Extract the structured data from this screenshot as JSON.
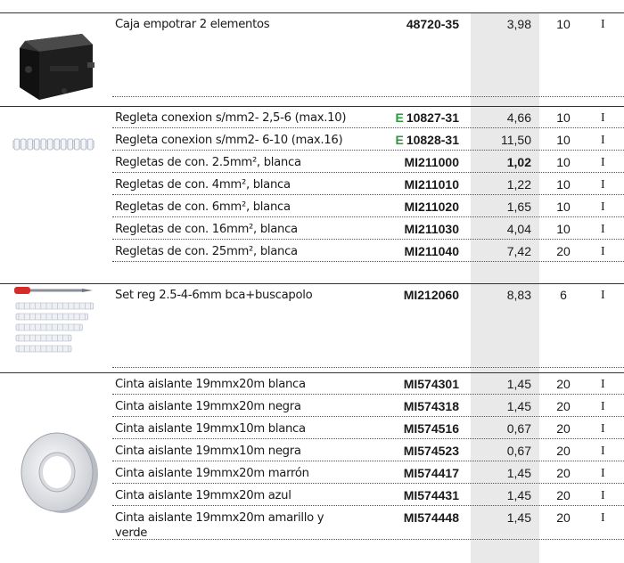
{
  "groups": [
    {
      "image": {
        "icon": "junction-box-image"
      },
      "items": [
        {
          "description": "Caja empotrar 2 elementos",
          "eco": "",
          "code": "48720-35",
          "price": "3,98",
          "qty": "10",
          "unit": "I",
          "bold_price": false
        }
      ]
    },
    {
      "image": {
        "icon": "terminal-strip-image"
      },
      "items": [
        {
          "description": "Regleta conexion s/mm2- 2,5-6 (max.10)",
          "eco": "E",
          "code": "10827-31",
          "price": "4,66",
          "qty": "10",
          "unit": "I",
          "bold_price": false
        },
        {
          "description": "Regleta conexion s/mm2- 6-10 (max.16)",
          "eco": "E",
          "code": "10828-31",
          "price": "11,50",
          "qty": "10",
          "unit": "I",
          "bold_price": false
        },
        {
          "description": "Regletas de con. 2.5mm², blanca",
          "eco": "",
          "code": "MI211000",
          "price": "1,02",
          "qty": "10",
          "unit": "I",
          "bold_price": true
        },
        {
          "description": "Regletas de con. 4mm², blanca",
          "eco": "",
          "code": "MI211010",
          "price": "1,22",
          "qty": "10",
          "unit": "I",
          "bold_price": false
        },
        {
          "description": "Regletas de con. 6mm², blanca",
          "eco": "",
          "code": "MI211020",
          "price": "1,65",
          "qty": "10",
          "unit": "I",
          "bold_price": false
        },
        {
          "description": "Regletas de con. 16mm², blanca",
          "eco": "",
          "code": "MI211030",
          "price": "4,04",
          "qty": "10",
          "unit": "I",
          "bold_price": false
        },
        {
          "description": "Regletas de con. 25mm², blanca",
          "eco": "",
          "code": "MI211040",
          "price": "7,42",
          "qty": "20",
          "unit": "I",
          "bold_price": false
        }
      ]
    },
    {
      "image": {
        "icon": "terminal-set-screwdriver-image"
      },
      "items": [
        {
          "description": "Set reg 2.5-4-6mm bca+buscapolo",
          "eco": "",
          "code": "MI212060",
          "price": "8,83",
          "qty": "6",
          "unit": "I",
          "bold_price": false
        }
      ]
    },
    {
      "image": {
        "icon": "insulating-tape-image"
      },
      "items": [
        {
          "description": "Cinta aislante 19mmx20m blanca",
          "eco": "",
          "code": "MI574301",
          "price": "1,45",
          "qty": "20",
          "unit": "I",
          "bold_price": false
        },
        {
          "description": "Cinta aislante 19mmx20m negra",
          "eco": "",
          "code": "MI574318",
          "price": "1,45",
          "qty": "20",
          "unit": "I",
          "bold_price": false
        },
        {
          "description": "Cinta aislante 19mmx10m blanca",
          "eco": "",
          "code": "MI574516",
          "price": "0,67",
          "qty": "20",
          "unit": "I",
          "bold_price": false
        },
        {
          "description": "Cinta aislante 19mmx10m negra",
          "eco": "",
          "code": "MI574523",
          "price": "0,67",
          "qty": "20",
          "unit": "I",
          "bold_price": false
        },
        {
          "description": "Cinta aislante 19mmx20m marrón",
          "eco": "",
          "code": "MI574417",
          "price": "1,45",
          "qty": "20",
          "unit": "I",
          "bold_price": false
        },
        {
          "description": "Cinta aislante 19mmx20m azul",
          "eco": "",
          "code": "MI574431",
          "price": "1,45",
          "qty": "20",
          "unit": "I",
          "bold_price": false
        },
        {
          "description": "Cinta aislante 19mmx20m amarillo y verde",
          "eco": "",
          "code": "MI574448",
          "price": "1,45",
          "qty": "20",
          "unit": "I",
          "bold_price": false
        }
      ]
    }
  ]
}
